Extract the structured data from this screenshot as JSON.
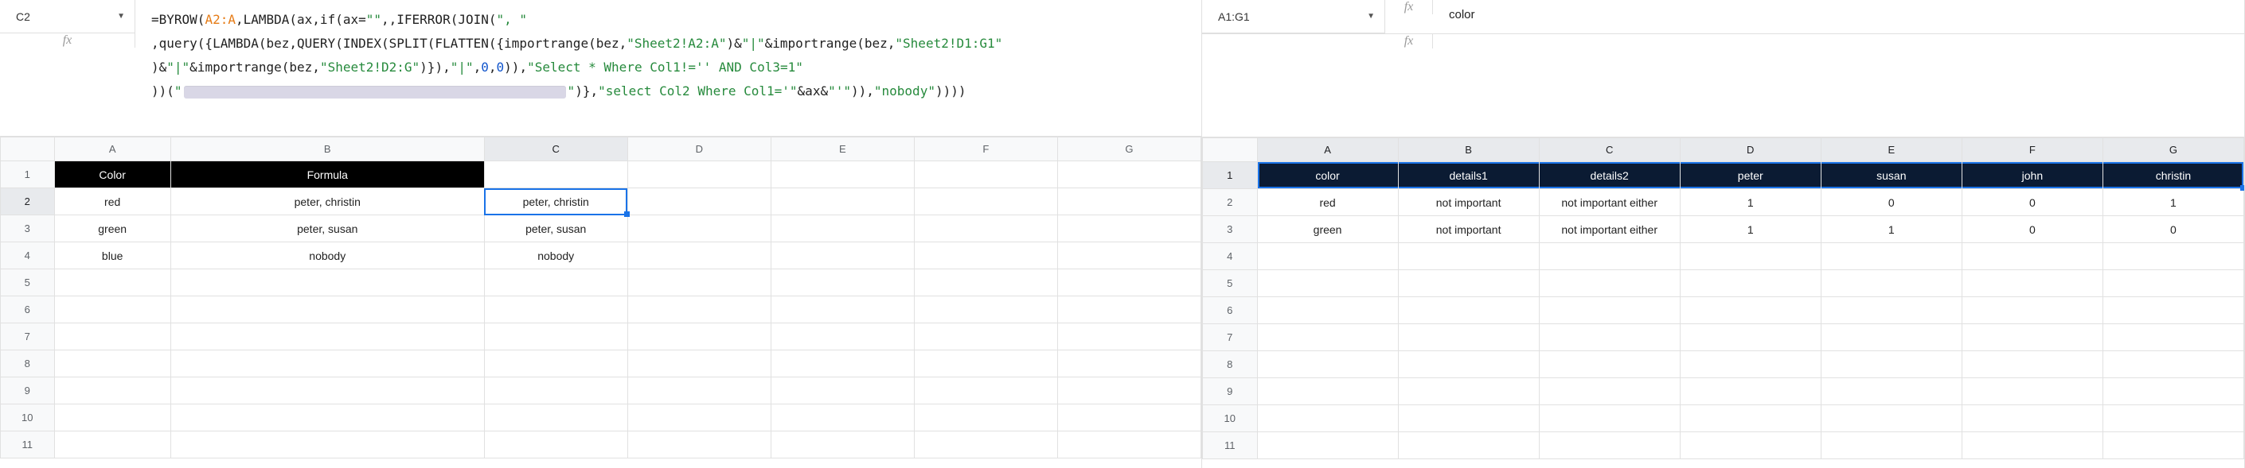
{
  "left": {
    "namebox": "C2",
    "formula_tokens": [
      {
        "t": "plain",
        "v": "=BYROW("
      },
      {
        "t": "range",
        "v": "A2:A"
      },
      {
        "t": "plain",
        "v": ",LAMBDA(ax,if(ax="
      },
      {
        "t": "str",
        "v": "\"\""
      },
      {
        "t": "plain",
        "v": ",,IFERROR(JOIN("
      },
      {
        "t": "str",
        "v": "\", \""
      },
      {
        "t": "plain",
        "v": ",query({LAMBDA(bez,QUERY(INDEX(SPLIT(FLATTEN({importrange(bez,"
      },
      {
        "t": "str",
        "v": "\"Sheet2!A2:A\""
      },
      {
        "t": "plain",
        "v": ")&"
      },
      {
        "t": "str",
        "v": "\"|\""
      },
      {
        "t": "plain",
        "v": "&importrange(bez,"
      },
      {
        "t": "str",
        "v": "\"Sheet2!D1:G1\""
      },
      {
        "t": "plain",
        "v": ")&"
      },
      {
        "t": "str",
        "v": "\"|\""
      },
      {
        "t": "plain",
        "v": "&importrange(bez,"
      },
      {
        "t": "str",
        "v": "\"Sheet2!D2:G\""
      },
      {
        "t": "plain",
        "v": ")}),"
      },
      {
        "t": "str",
        "v": "\"|\""
      },
      {
        "t": "plain",
        "v": ","
      },
      {
        "t": "num",
        "v": "0"
      },
      {
        "t": "plain",
        "v": ","
      },
      {
        "t": "num",
        "v": "0"
      },
      {
        "t": "plain",
        "v": ")),"
      },
      {
        "t": "str",
        "v": "\"Select * Where Col1!='' AND Col3=1\""
      },
      {
        "t": "plain",
        "v": "))("
      },
      {
        "t": "str",
        "v": "\""
      },
      {
        "t": "redact",
        "v": ""
      },
      {
        "t": "str",
        "v": "\""
      },
      {
        "t": "plain",
        "v": ")},"
      },
      {
        "t": "str",
        "v": "\"select Col2 Where Col1='\""
      },
      {
        "t": "plain",
        "v": "&ax&"
      },
      {
        "t": "str",
        "v": "\"'\""
      },
      {
        "t": "plain",
        "v": ")),"
      },
      {
        "t": "str",
        "v": "\"nobody\""
      },
      {
        "t": "plain",
        "v": ")))) "
      }
    ],
    "formula_line_starts": [
      0,
      6,
      12,
      24
    ],
    "columns": [
      "A",
      "B",
      "C",
      "D",
      "E",
      "F",
      "G"
    ],
    "header_row": [
      "Color",
      "Formula",
      "",
      "",
      "",
      "",
      ""
    ],
    "rows": [
      [
        "red",
        "peter, christin",
        "peter, christin",
        "",
        "",
        "",
        ""
      ],
      [
        "green",
        "peter, susan",
        "peter, susan",
        "",
        "",
        "",
        ""
      ],
      [
        "blue",
        "nobody",
        "nobody",
        "",
        "",
        "",
        ""
      ]
    ],
    "active_cell": {
      "row": 2,
      "col": "C"
    }
  },
  "right": {
    "namebox": "A1:G1",
    "formula_value": "color",
    "columns": [
      "A",
      "B",
      "C",
      "D",
      "E",
      "F",
      "G"
    ],
    "header_row": [
      "color",
      "details1",
      "details2",
      "peter",
      "susan",
      "john",
      "christin"
    ],
    "rows": [
      [
        "red",
        "not important",
        "not important either",
        "1",
        "0",
        "0",
        "1"
      ],
      [
        "green",
        "not important",
        "not important either",
        "1",
        "1",
        "0",
        "0"
      ]
    ]
  },
  "row_labels": [
    "1",
    "2",
    "3",
    "4",
    "5",
    "6",
    "7",
    "8",
    "9",
    "10",
    "11"
  ]
}
